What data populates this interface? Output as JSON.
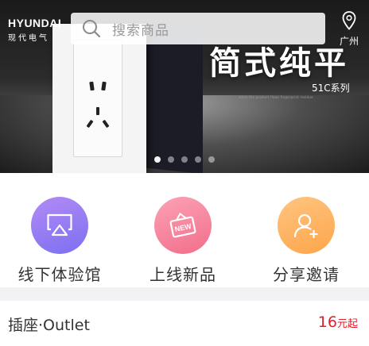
{
  "brand": {
    "name_en": "HYUNDAI",
    "name_cn": "现代电气"
  },
  "search": {
    "placeholder": "搜索商品"
  },
  "location": {
    "city": "广州"
  },
  "banner": {
    "slogan": "简式纯平",
    "series": "51C系列",
    "fine_print": "when the product flows fingerprint residue",
    "slide_count": 5,
    "active_slide": 0
  },
  "quick_links": [
    {
      "label": "线下体验馆",
      "icon": "airplay-icon",
      "color_from": "#b38bf5",
      "color_to": "#7c6ff1"
    },
    {
      "label": "上线新品",
      "icon": "new-tag-icon",
      "color_from": "#fba2b6",
      "color_to": "#f26e8a"
    },
    {
      "label": "分享邀请",
      "icon": "add-user-icon",
      "color_from": "#ffc580",
      "color_to": "#fda54a"
    }
  ],
  "section": {
    "title": "插座·Outlet",
    "price": "16",
    "price_unit": "元起"
  },
  "colors": {
    "accent_price": "#e0202a"
  }
}
